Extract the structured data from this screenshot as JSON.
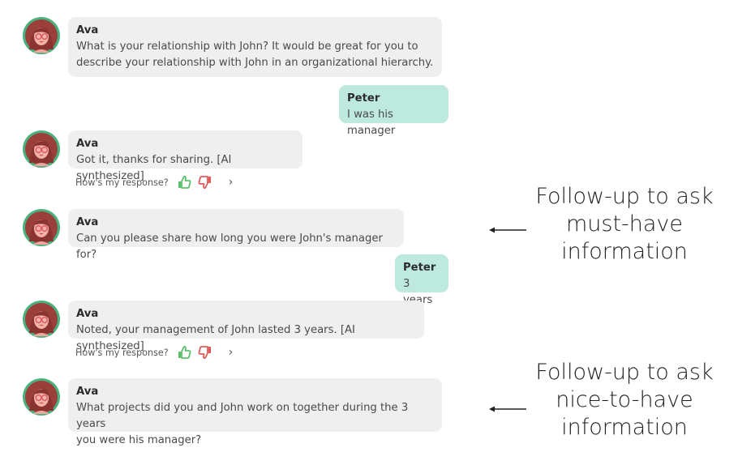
{
  "messages": [
    {
      "sender": "Ava",
      "text": "What is your relationship with John? It would be great for you to\ndescribe your relationship with John in an organizational hierarchy."
    },
    {
      "sender": "Peter",
      "text": "I was his manager"
    },
    {
      "sender": "Ava",
      "text": "Got it, thanks for sharing. [AI synthesized]"
    },
    {
      "sender": "Ava",
      "text": "Can you please share how long you were John's manager for?"
    },
    {
      "sender": "Peter",
      "text": "3 years"
    },
    {
      "sender": "Ava",
      "text": "Noted, your management of John lasted 3 years. [AI synthesized]"
    },
    {
      "sender": "Ava",
      "text": "What projects did you and John work on together during the 3 years\nyou were his manager?"
    }
  ],
  "feedback": {
    "label": "How's my response?",
    "thumbs_up_color": "#5cc06a",
    "thumbs_down_color": "#e05a5a",
    "chevron": "›"
  },
  "annotations": [
    {
      "text": "Follow-up to ask\nmust-have\ninformation"
    },
    {
      "text": "Follow-up to ask\nnice-to-have\ninformation"
    }
  ],
  "colors": {
    "assistant_bubble": "#efefef",
    "user_bubble": "#bde9de",
    "avatar_ring": "#49b37f"
  }
}
